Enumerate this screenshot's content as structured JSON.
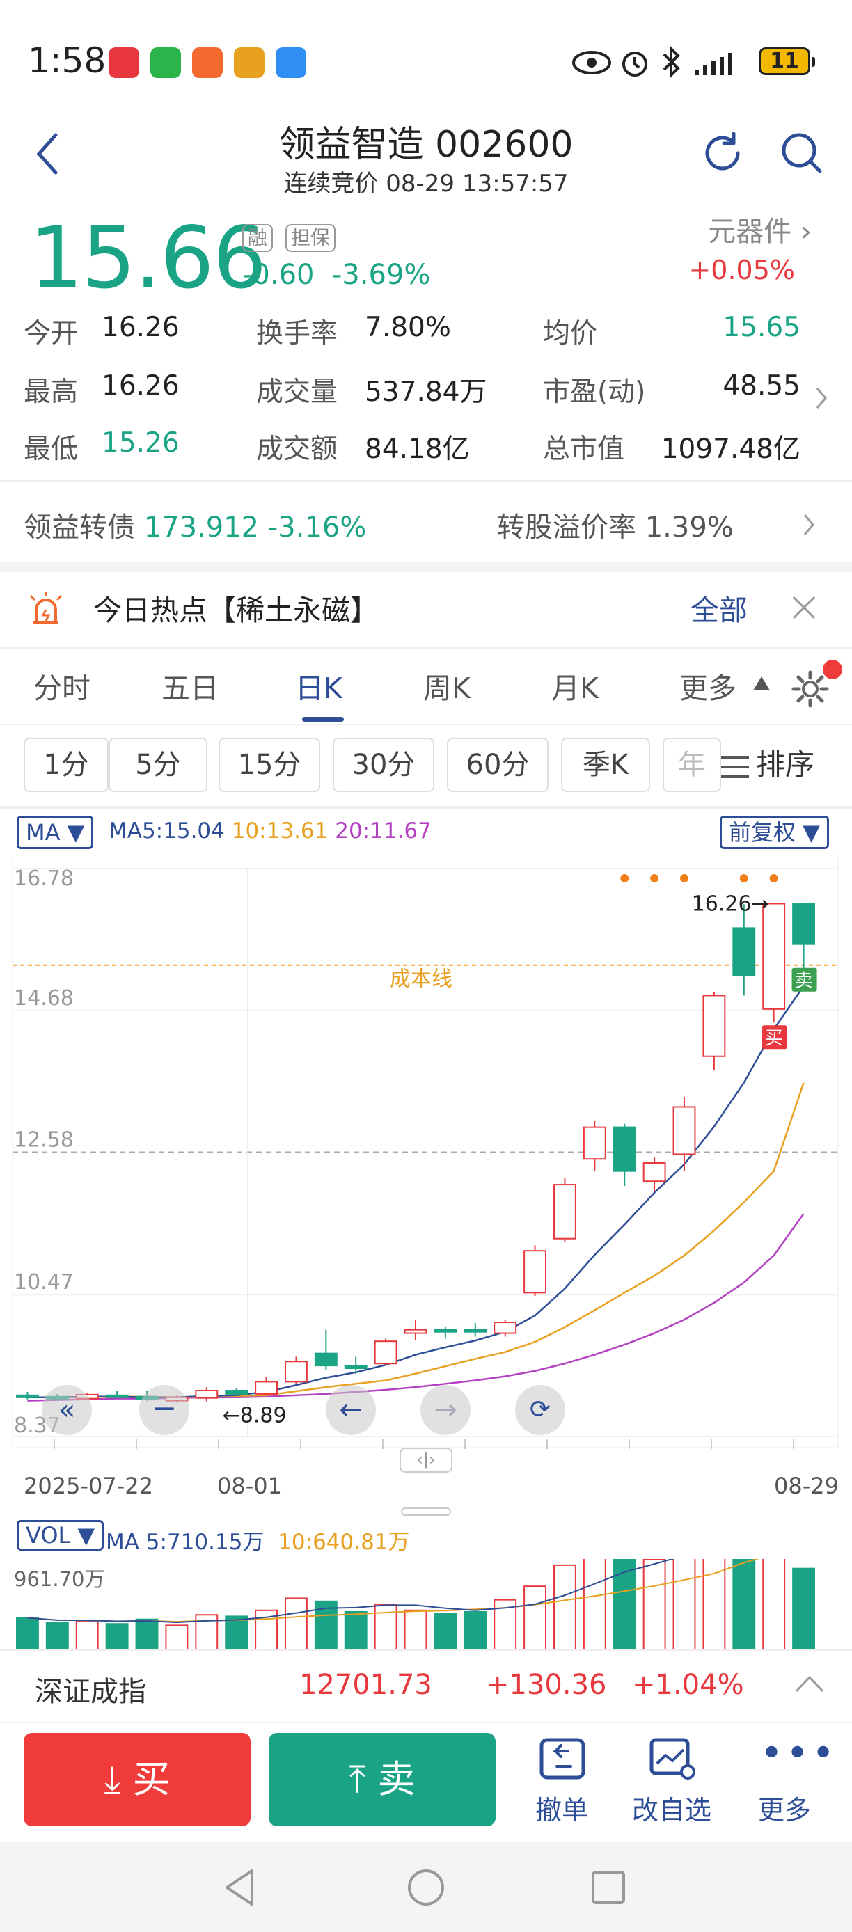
{
  "status_bar": {
    "time": "1:58",
    "battery": "11"
  },
  "header": {
    "title": "领益智造 002600",
    "subtitle": "连续竞价 08-29 13:57:57"
  },
  "quote": {
    "price": "15.66",
    "tag_margin": "融",
    "tag_collateral": "担保",
    "change": "-0.60",
    "change_pct": "-3.69%",
    "sector": "元器件",
    "sector_change": "+0.05%"
  },
  "stats": [
    {
      "label": "今开",
      "value": "16.26",
      "color": "#222222"
    },
    {
      "label": "换手率",
      "value": "7.80%",
      "color": "#222222"
    },
    {
      "label": "均价",
      "value": "15.65",
      "color": "#1aa485"
    },
    {
      "label": "最高",
      "value": "16.26",
      "color": "#222222"
    },
    {
      "label": "成交量",
      "value": "537.84万",
      "color": "#222222"
    },
    {
      "label": "市盈(动)",
      "value": "48.55",
      "color": "#222222"
    },
    {
      "label": "最低",
      "value": "15.26",
      "color": "#1aa485"
    },
    {
      "label": "成交额",
      "value": "84.18亿",
      "color": "#222222"
    },
    {
      "label": "总市值",
      "value": "1097.48亿",
      "color": "#222222"
    }
  ],
  "bond": {
    "name": "领益转债",
    "price": "173.912",
    "change_pct": "-3.16%",
    "premium_label": "转股溢价率",
    "premium": "1.39%"
  },
  "hot_topic": {
    "text": "今日热点【稀土永磁】",
    "all_label": "全部"
  },
  "period_tabs": [
    "分时",
    "五日",
    "日K",
    "周K",
    "月K",
    "更多"
  ],
  "active_tab": "日K",
  "interval_buttons": [
    "1分",
    "5分",
    "15分",
    "30分",
    "60分",
    "季K",
    "年"
  ],
  "sort_label": "排序",
  "kline": {
    "ma_selector": "MA",
    "ma5": "MA5:15.04",
    "ma10": "10:13.61",
    "ma20": "20:11.67",
    "adjust": "前复权",
    "cost_line_label": "成本线",
    "high_marker": "16.26",
    "low_marker": "8.89",
    "buy_marker": "买",
    "sell_marker": "卖",
    "date_start": "2025-07-22",
    "date_mid": "08-01",
    "date_end": "08-29",
    "colors": {
      "up": "#e8383d",
      "down": "#1aa485",
      "ma5": "#2d4e96",
      "ma10": "#e8a020",
      "ma20": "#b340c0",
      "cost": "#e8a020"
    }
  },
  "volume": {
    "selector": "VOL",
    "ma5": "MA 5:710.15万",
    "ma10": "10:640.81万",
    "axis_top": "961.70万"
  },
  "chart_data": [
    {
      "type": "candlestick",
      "x_range": [
        "2025-07-22",
        "2025-08-29"
      ],
      "y_ticks": [
        "16.78",
        "14.68",
        "12.58",
        "10.47",
        "8.37"
      ],
      "ylim": [
        8.37,
        16.78
      ],
      "cost_line": 15.35,
      "candles": [
        {
          "o": 8.98,
          "h": 9.03,
          "l": 8.92,
          "c": 8.95
        },
        {
          "o": 8.96,
          "h": 9.0,
          "l": 8.9,
          "c": 8.94
        },
        {
          "o": 8.93,
          "h": 9.02,
          "l": 8.92,
          "c": 8.99
        },
        {
          "o": 8.98,
          "h": 9.05,
          "l": 8.95,
          "c": 8.96
        },
        {
          "o": 8.96,
          "h": 9.04,
          "l": 8.9,
          "c": 8.92
        },
        {
          "o": 8.9,
          "h": 8.98,
          "l": 8.87,
          "c": 8.95
        },
        {
          "o": 8.94,
          "h": 9.1,
          "l": 8.89,
          "c": 9.05
        },
        {
          "o": 9.05,
          "h": 9.08,
          "l": 8.97,
          "c": 9.0
        },
        {
          "o": 9.0,
          "h": 9.25,
          "l": 8.98,
          "c": 9.18
        },
        {
          "o": 9.18,
          "h": 9.55,
          "l": 9.15,
          "c": 9.48
        },
        {
          "o": 9.6,
          "h": 9.95,
          "l": 9.35,
          "c": 9.42
        },
        {
          "o": 9.42,
          "h": 9.55,
          "l": 9.3,
          "c": 9.38
        },
        {
          "o": 9.45,
          "h": 9.82,
          "l": 9.42,
          "c": 9.78
        },
        {
          "o": 9.9,
          "h": 10.1,
          "l": 9.8,
          "c": 9.95
        },
        {
          "o": 9.95,
          "h": 10.0,
          "l": 9.82,
          "c": 9.92
        },
        {
          "o": 9.95,
          "h": 10.05,
          "l": 9.85,
          "c": 9.93
        },
        {
          "o": 9.9,
          "h": 10.1,
          "l": 9.85,
          "c": 10.06
        },
        {
          "o": 10.5,
          "h": 11.2,
          "l": 10.45,
          "c": 11.12
        },
        {
          "o": 11.3,
          "h": 12.2,
          "l": 11.25,
          "c": 12.1
        },
        {
          "o": 12.48,
          "h": 13.05,
          "l": 12.3,
          "c": 12.95
        },
        {
          "o": 12.95,
          "h": 13.0,
          "l": 12.08,
          "c": 12.3
        },
        {
          "o": 12.15,
          "h": 12.5,
          "l": 12.0,
          "c": 12.42
        },
        {
          "o": 12.55,
          "h": 13.4,
          "l": 12.3,
          "c": 13.25
        },
        {
          "o": 14.0,
          "h": 14.95,
          "l": 13.8,
          "c": 14.9
        },
        {
          "o": 15.9,
          "h": 16.25,
          "l": 14.9,
          "c": 15.2
        },
        {
          "o": 14.7,
          "h": 16.26,
          "l": 14.5,
          "c": 16.26
        },
        {
          "o": 16.26,
          "h": 16.26,
          "l": 15.26,
          "c": 15.66
        }
      ],
      "ma5": [
        8.95,
        8.95,
        8.96,
        8.96,
        8.95,
        8.95,
        8.97,
        8.98,
        9.03,
        9.13,
        9.24,
        9.32,
        9.43,
        9.58,
        9.69,
        9.79,
        9.92,
        10.16,
        10.56,
        11.06,
        11.51,
        11.98,
        12.4,
        12.96,
        13.61,
        14.4,
        15.04
      ],
      "ma10": [
        8.95,
        8.95,
        8.95,
        8.96,
        8.96,
        8.95,
        8.96,
        8.97,
        8.98,
        9.04,
        9.1,
        9.15,
        9.2,
        9.3,
        9.41,
        9.52,
        9.62,
        9.77,
        9.99,
        10.24,
        10.5,
        10.75,
        11.05,
        11.42,
        11.84,
        12.3,
        13.61
      ],
      "ma20": [
        8.9,
        8.91,
        8.92,
        8.93,
        8.93,
        8.94,
        8.95,
        8.95,
        8.96,
        8.98,
        9.0,
        9.03,
        9.06,
        9.1,
        9.15,
        9.2,
        9.26,
        9.34,
        9.45,
        9.58,
        9.73,
        9.9,
        10.1,
        10.35,
        10.65,
        11.05,
        11.67
      ]
    },
    {
      "type": "bar",
      "name": "VOL",
      "ylim": [
        0,
        961.7
      ],
      "unit": "万",
      "values": [
        210,
        180,
        190,
        170,
        200,
        160,
        230,
        220,
        260,
        340,
        320,
        250,
        300,
        260,
        240,
        250,
        330,
        420,
        560,
        620,
        640,
        600,
        700,
        680,
        961.7,
        830,
        537.84
      ]
    }
  ],
  "index_bar": {
    "name": "深证成指",
    "value": "12701.73",
    "change": "+130.36",
    "change_pct": "+1.04%"
  },
  "actions": {
    "buy": "买",
    "sell": "卖",
    "cancel": "撤单",
    "watchlist": "改自选",
    "more": "更多"
  }
}
